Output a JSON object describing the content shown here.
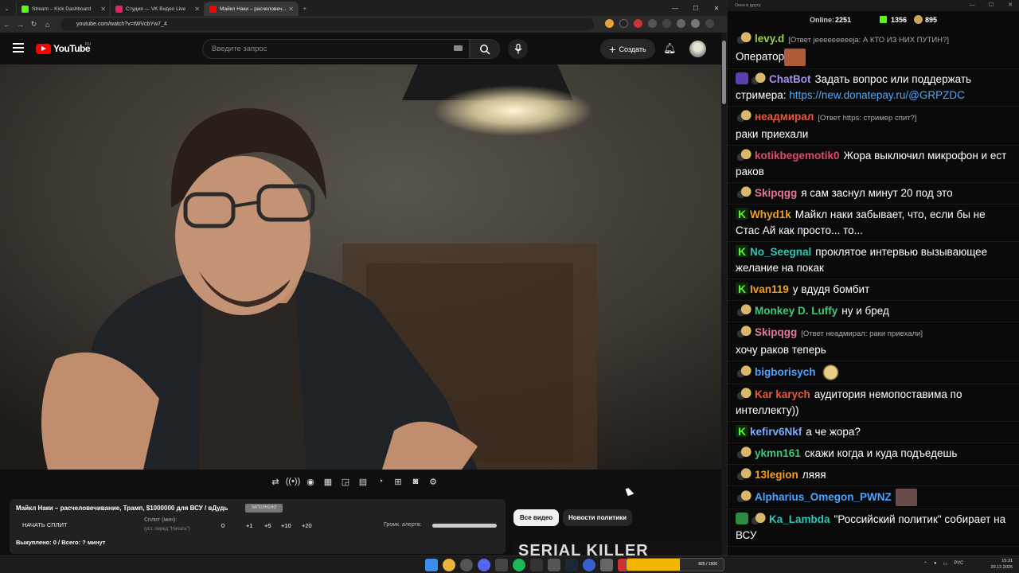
{
  "browser": {
    "tabs": [
      {
        "title": "Stream – Kick Dashboard",
        "color": "#53fc18"
      },
      {
        "title": "Студия — VK Видео Live",
        "color": "#e0245e"
      },
      {
        "title": "Майкл Наки – расчеловеч...",
        "color": "#ff0000"
      }
    ],
    "url": "youtube.com/watch?v=tWVcbYw7_4"
  },
  "youtube": {
    "logo_text": "YouTube",
    "logo_region": "RU",
    "search_placeholder": "Введите запрос",
    "create_label": "Создать"
  },
  "split": {
    "title": "Майкл Наки – расчеловечивание, Трамп, $1000000 для ВСУ / вДудь",
    "badge": "ЗАПОЛНЕНО",
    "start_label": "НАЧАТЬ СПЛИТ",
    "minutes_label": "Сплит (мин):",
    "minutes_hint": "(уст. перед \"Начать\")",
    "minutes_value": "0",
    "increments": [
      "+1",
      "+5",
      "+10",
      "+20"
    ],
    "alert_volume_label": "Громк. алерта:",
    "footer": "Выкуплено: 0 / Всего: ? минут"
  },
  "chips": [
    "Все видео",
    "Новости политики"
  ],
  "thumbnail_text": "SERIAL KILLER",
  "chat": {
    "window_title": "Окно в другу",
    "online_label": "Online:",
    "online_value": "2251",
    "kick_count": "1356",
    "other_count": "895",
    "messages": [
      {
        "nick": "levy.d",
        "color": "#9ad14b",
        "badges": [
          "smile"
        ],
        "reply": "[Ответ јеееееееееја: А КТО ИЗ НИХ ПУТИН?]",
        "text": "Оператор",
        "emote": true
      },
      {
        "nick": "ChatBot",
        "color": "#a98ff0",
        "badges": [
          "bot",
          "smile"
        ],
        "reply": "",
        "text": "Задать вопрос или поддержать стримера: ",
        "link": "https://new.donatepay.ru/@GRPZDC"
      },
      {
        "nick": "неадмирал",
        "color": "#e8583c",
        "badges": [
          "smile"
        ],
        "reply": "[Ответ https: стример спит?]",
        "text": "раки приехали"
      },
      {
        "nick": "kotikbegemotik0",
        "color": "#e0486b",
        "badges": [
          "smile"
        ],
        "reply": "",
        "text": "Жора выключил микрофон и ест раков"
      },
      {
        "nick": "Skipqgg",
        "color": "#e5739f",
        "badges": [
          "smile"
        ],
        "reply": "",
        "text": "я сам заснул минут 20 под это"
      },
      {
        "nick": "Whyd1k",
        "color": "#f0a020",
        "badges": [
          "kick"
        ],
        "reply": "",
        "text": "Майкл наки забывает, что, если бы не Стас Ай как просто... то..."
      },
      {
        "nick": "No_Seegnal",
        "color": "#2cc8b4",
        "badges": [
          "kick"
        ],
        "reply": "",
        "text": "проклятое интервью вызывающее желание на покак"
      },
      {
        "nick": "Ivan119",
        "color": "#f0a020",
        "badges": [
          "kick"
        ],
        "reply": "",
        "text": "у вдудя бомбит"
      },
      {
        "nick": "Monkey D. Luffy",
        "color": "#3cc87a",
        "badges": [
          "smile"
        ],
        "reply": "",
        "text": "ну и бред"
      },
      {
        "nick": "Skipqgg",
        "color": "#e5739f",
        "badges": [
          "smile"
        ],
        "reply": "[Ответ неадмирал: раки приехали]",
        "text": "хочу раков теперь"
      },
      {
        "nick": "bigborisych",
        "color": "#4da3ff",
        "badges": [
          "smile"
        ],
        "reply": "",
        "text": "",
        "emote": true
      },
      {
        "nick": "Kar karych",
        "color": "#e8583c",
        "badges": [
          "smile"
        ],
        "reply": "",
        "text": "аудитория немопоставима по интеллекту))"
      },
      {
        "nick": "kefirv6Nkf",
        "color": "#7aa8ff",
        "badges": [
          "kick"
        ],
        "reply": "",
        "text": "а че жора?"
      },
      {
        "nick": "ykmn161",
        "color": "#3cc87a",
        "badges": [
          "smile"
        ],
        "reply": "",
        "text": "скажи когда и куда подъедешь"
      },
      {
        "nick": "13legion",
        "color": "#f0a020",
        "badges": [
          "smile"
        ],
        "reply": "",
        "text": "ляяя"
      },
      {
        "nick": "Alpharius_Omegon_PWNZ",
        "color": "#4da3ff",
        "badges": [
          "smile"
        ],
        "reply": "",
        "text": "",
        "emote": true
      },
      {
        "nick": "Ka_Lambda",
        "color": "#2cc8b4",
        "badges": [
          "shield",
          "smile"
        ],
        "reply": "",
        "text": "\"Российский политик\" собирает на ВСУ"
      }
    ]
  },
  "taskbar": {
    "widget_text": "825 / 1500",
    "widget_progress": 0.55,
    "lang": "РУС",
    "time": "15:31",
    "date": "20.12.2025"
  }
}
